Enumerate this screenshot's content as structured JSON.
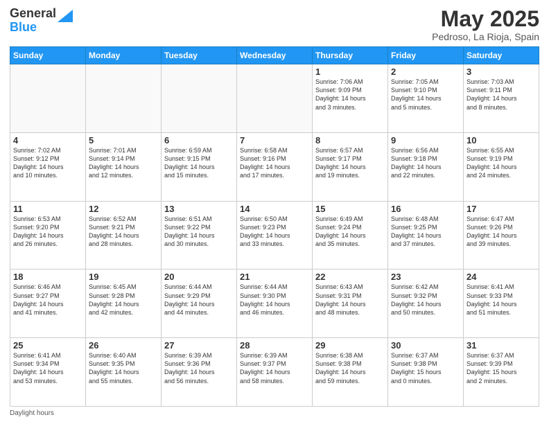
{
  "logo": {
    "general": "General",
    "blue": "Blue"
  },
  "title": "May 2025",
  "subtitle": "Pedroso, La Rioja, Spain",
  "days_of_week": [
    "Sunday",
    "Monday",
    "Tuesday",
    "Wednesday",
    "Thursday",
    "Friday",
    "Saturday"
  ],
  "weeks": [
    [
      {
        "day": "",
        "info": ""
      },
      {
        "day": "",
        "info": ""
      },
      {
        "day": "",
        "info": ""
      },
      {
        "day": "",
        "info": ""
      },
      {
        "day": "1",
        "info": "Sunrise: 7:06 AM\nSunset: 9:09 PM\nDaylight: 14 hours\nand 3 minutes."
      },
      {
        "day": "2",
        "info": "Sunrise: 7:05 AM\nSunset: 9:10 PM\nDaylight: 14 hours\nand 5 minutes."
      },
      {
        "day": "3",
        "info": "Sunrise: 7:03 AM\nSunset: 9:11 PM\nDaylight: 14 hours\nand 8 minutes."
      }
    ],
    [
      {
        "day": "4",
        "info": "Sunrise: 7:02 AM\nSunset: 9:12 PM\nDaylight: 14 hours\nand 10 minutes."
      },
      {
        "day": "5",
        "info": "Sunrise: 7:01 AM\nSunset: 9:14 PM\nDaylight: 14 hours\nand 12 minutes."
      },
      {
        "day": "6",
        "info": "Sunrise: 6:59 AM\nSunset: 9:15 PM\nDaylight: 14 hours\nand 15 minutes."
      },
      {
        "day": "7",
        "info": "Sunrise: 6:58 AM\nSunset: 9:16 PM\nDaylight: 14 hours\nand 17 minutes."
      },
      {
        "day": "8",
        "info": "Sunrise: 6:57 AM\nSunset: 9:17 PM\nDaylight: 14 hours\nand 19 minutes."
      },
      {
        "day": "9",
        "info": "Sunrise: 6:56 AM\nSunset: 9:18 PM\nDaylight: 14 hours\nand 22 minutes."
      },
      {
        "day": "10",
        "info": "Sunrise: 6:55 AM\nSunset: 9:19 PM\nDaylight: 14 hours\nand 24 minutes."
      }
    ],
    [
      {
        "day": "11",
        "info": "Sunrise: 6:53 AM\nSunset: 9:20 PM\nDaylight: 14 hours\nand 26 minutes."
      },
      {
        "day": "12",
        "info": "Sunrise: 6:52 AM\nSunset: 9:21 PM\nDaylight: 14 hours\nand 28 minutes."
      },
      {
        "day": "13",
        "info": "Sunrise: 6:51 AM\nSunset: 9:22 PM\nDaylight: 14 hours\nand 30 minutes."
      },
      {
        "day": "14",
        "info": "Sunrise: 6:50 AM\nSunset: 9:23 PM\nDaylight: 14 hours\nand 33 minutes."
      },
      {
        "day": "15",
        "info": "Sunrise: 6:49 AM\nSunset: 9:24 PM\nDaylight: 14 hours\nand 35 minutes."
      },
      {
        "day": "16",
        "info": "Sunrise: 6:48 AM\nSunset: 9:25 PM\nDaylight: 14 hours\nand 37 minutes."
      },
      {
        "day": "17",
        "info": "Sunrise: 6:47 AM\nSunset: 9:26 PM\nDaylight: 14 hours\nand 39 minutes."
      }
    ],
    [
      {
        "day": "18",
        "info": "Sunrise: 6:46 AM\nSunset: 9:27 PM\nDaylight: 14 hours\nand 41 minutes."
      },
      {
        "day": "19",
        "info": "Sunrise: 6:45 AM\nSunset: 9:28 PM\nDaylight: 14 hours\nand 42 minutes."
      },
      {
        "day": "20",
        "info": "Sunrise: 6:44 AM\nSunset: 9:29 PM\nDaylight: 14 hours\nand 44 minutes."
      },
      {
        "day": "21",
        "info": "Sunrise: 6:44 AM\nSunset: 9:30 PM\nDaylight: 14 hours\nand 46 minutes."
      },
      {
        "day": "22",
        "info": "Sunrise: 6:43 AM\nSunset: 9:31 PM\nDaylight: 14 hours\nand 48 minutes."
      },
      {
        "day": "23",
        "info": "Sunrise: 6:42 AM\nSunset: 9:32 PM\nDaylight: 14 hours\nand 50 minutes."
      },
      {
        "day": "24",
        "info": "Sunrise: 6:41 AM\nSunset: 9:33 PM\nDaylight: 14 hours\nand 51 minutes."
      }
    ],
    [
      {
        "day": "25",
        "info": "Sunrise: 6:41 AM\nSunset: 9:34 PM\nDaylight: 14 hours\nand 53 minutes."
      },
      {
        "day": "26",
        "info": "Sunrise: 6:40 AM\nSunset: 9:35 PM\nDaylight: 14 hours\nand 55 minutes."
      },
      {
        "day": "27",
        "info": "Sunrise: 6:39 AM\nSunset: 9:36 PM\nDaylight: 14 hours\nand 56 minutes."
      },
      {
        "day": "28",
        "info": "Sunrise: 6:39 AM\nSunset: 9:37 PM\nDaylight: 14 hours\nand 58 minutes."
      },
      {
        "day": "29",
        "info": "Sunrise: 6:38 AM\nSunset: 9:38 PM\nDaylight: 14 hours\nand 59 minutes."
      },
      {
        "day": "30",
        "info": "Sunrise: 6:37 AM\nSunset: 9:38 PM\nDaylight: 15 hours\nand 0 minutes."
      },
      {
        "day": "31",
        "info": "Sunrise: 6:37 AM\nSunset: 9:39 PM\nDaylight: 15 hours\nand 2 minutes."
      }
    ]
  ],
  "footer": "Daylight hours"
}
